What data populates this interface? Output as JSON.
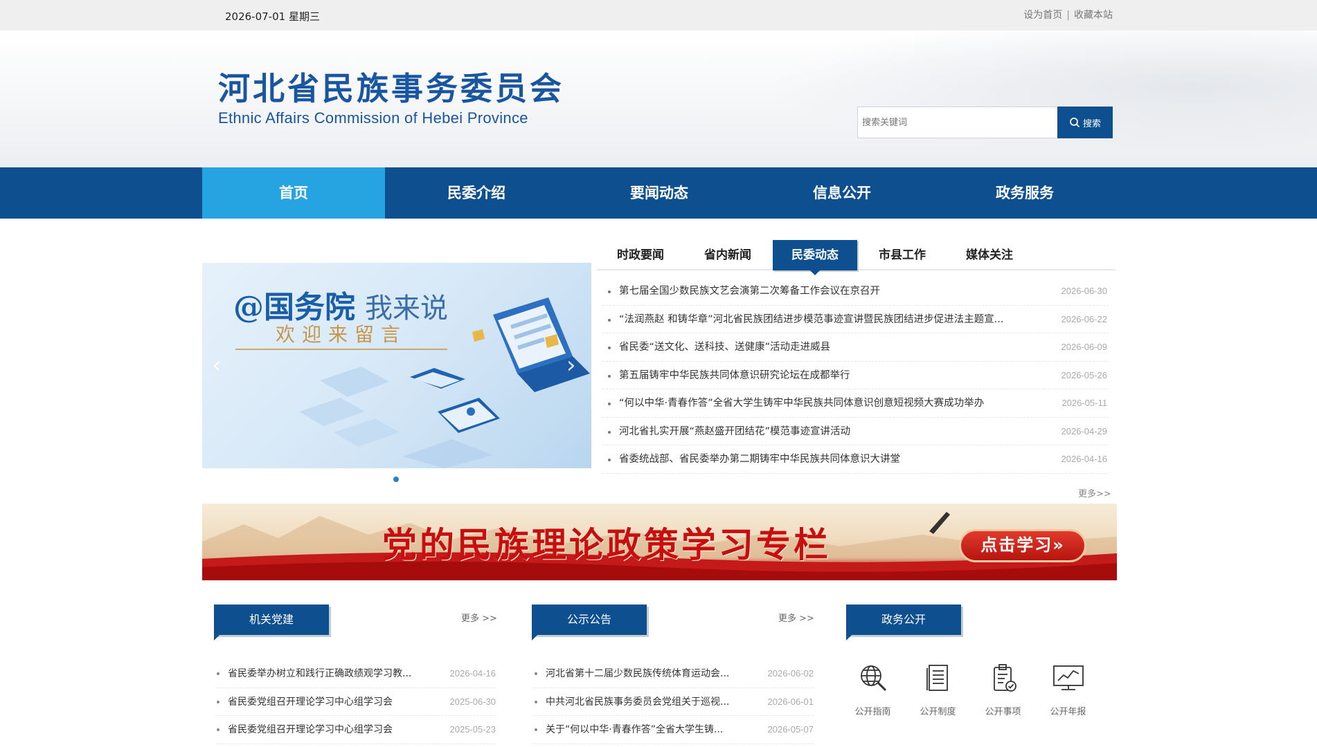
{
  "topbar": {
    "date": "2026-07-01 星期三",
    "set_home": "设为首页",
    "separator": "|",
    "bookmark": "收藏本站"
  },
  "header": {
    "logo_cn": "河北省民族事务委员会",
    "logo_en": "Ethnic Affairs Commission of Hebei Province",
    "search_placeholder": "搜索关键词",
    "search_button": "搜索"
  },
  "nav": {
    "items": [
      "首页",
      "民委介绍",
      "要闻动态",
      "信息公开",
      "政务服务"
    ],
    "active_index": 0
  },
  "carousel": {
    "title_main": "@国务院",
    "title_light": "我来说",
    "subtitle": "欢迎来留言",
    "prev": "‹",
    "next": "›",
    "slides": 1
  },
  "news": {
    "tabs": [
      "时政要闻",
      "省内新闻",
      "民委动态",
      "市县工作",
      "媒体关注"
    ],
    "active_tab": 2,
    "items": [
      {
        "title": "第七届全国少数民族文艺会演第二次筹备工作会议在京召开",
        "date": "2026-06-30"
      },
      {
        "title": "“法润燕赵 和铸华章”河北省民族团结进步模范事迹宣讲暨民族团结进步促进法主题宣...",
        "date": "2026-06-22"
      },
      {
        "title": "省民委“送文化、送科技、送健康”活动走进威县",
        "date": "2026-06-09"
      },
      {
        "title": "第五届铸牢中华民族共同体意识研究论坛在成都举行",
        "date": "2026-05-26"
      },
      {
        "title": "“何以中华·青春作答”全省大学生铸牢中华民族共同体意识创意短视频大赛成功举办",
        "date": "2026-05-11"
      },
      {
        "title": "河北省扎实开展“燕赵盛开团结花”模范事迹宣讲活动",
        "date": "2026-04-29"
      },
      {
        "title": "省委统战部、省民委举办第二期铸牢中华民族共同体意识大讲堂",
        "date": "2026-04-16"
      }
    ],
    "more": "更多>>"
  },
  "banner": {
    "title": "党的民族理论政策学习专栏",
    "button": "点击学习»"
  },
  "sections": {
    "party": {
      "title": "机关党建",
      "more": "更多 >>",
      "items": [
        {
          "title": "省民委举办树立和践行正确政绩观学习教...",
          "date": "2026-04-16"
        },
        {
          "title": "省民委党组召开理论学习中心组学习会",
          "date": "2025-06-30"
        },
        {
          "title": "省民委党组召开理论学习中心组学习会",
          "date": "2025-05-23"
        }
      ]
    },
    "notice": {
      "title": "公示公告",
      "more": "更多 >>",
      "items": [
        {
          "title": "河北省第十二届少数民族传统体育运动会...",
          "date": "2026-06-02"
        },
        {
          "title": "中共河北省民族事务委员会党组关于巡视...",
          "date": "2026-06-01"
        },
        {
          "title": "关于“何以中华·青春作答”全省大学生铸...",
          "date": "2026-05-07"
        }
      ]
    },
    "gov": {
      "title": "政务公开",
      "items": [
        {
          "label": "公开指南",
          "icon": "globe-search-icon"
        },
        {
          "label": "公开制度",
          "icon": "document-list-icon"
        },
        {
          "label": "公开事项",
          "icon": "clipboard-check-icon"
        },
        {
          "label": "公开年报",
          "icon": "chart-report-icon"
        }
      ]
    }
  },
  "colors": {
    "primary": "#0e4f8f",
    "nav_active": "#26a4e1",
    "banner_red": "#c80f0f"
  }
}
